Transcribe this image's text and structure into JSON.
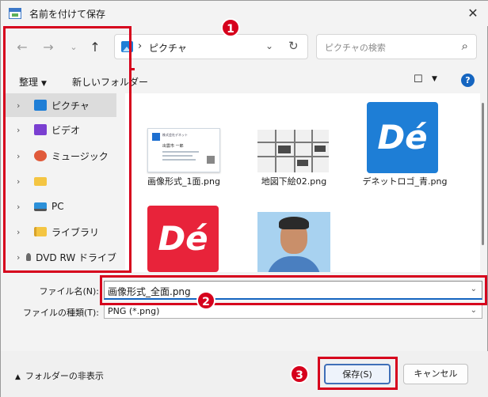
{
  "window": {
    "title": "名前を付けて保存",
    "close_glyph": "✕"
  },
  "nav": {
    "path_current": "ピクチャ",
    "search_placeholder": "ピクチャの検索"
  },
  "toolbar": {
    "organize_label": "整理",
    "new_folder_label": "新しいフォルダー"
  },
  "navpane": {
    "items": [
      {
        "label": "ピクチャ",
        "icon": "pictures-icon"
      },
      {
        "label": "ビデオ",
        "icon": "videos-icon"
      },
      {
        "label": "ミュージック",
        "icon": "music-icon"
      },
      {
        "label": "",
        "icon": "folder-icon"
      },
      {
        "label": "PC",
        "icon": "pc-icon"
      },
      {
        "label": "ライブラリ",
        "icon": "library-icon"
      },
      {
        "label": "DVD RW ドライブ",
        "icon": "dvd-drive-icon"
      }
    ]
  },
  "files": [
    {
      "name": "画像形式_1面.png"
    },
    {
      "name": "地図下絵02.png"
    },
    {
      "name": "デネットロゴ_青.png"
    },
    {
      "name": ""
    },
    {
      "name": ""
    }
  ],
  "logo_text": "Dé",
  "card_text": {
    "company": "株式会社デネット",
    "person": "出雲市 一郎"
  },
  "form": {
    "filename_label": "ファイル名(N):",
    "filename_value": "画像形式_全面.png",
    "filetype_label": "ファイルの種類(T):",
    "filetype_value": "PNG (*.png)"
  },
  "footer": {
    "hide_folders_label": "フォルダーの非表示",
    "save_label": "保存(S)",
    "cancel_label": "キャンセル"
  },
  "annotations": {
    "badge1": "1",
    "badge2": "2",
    "badge3": "3"
  },
  "colors": {
    "accent": "#1565c0",
    "callout": "#d6001c",
    "logo_blue": "#1e7ed6",
    "logo_red": "#e8233a"
  }
}
